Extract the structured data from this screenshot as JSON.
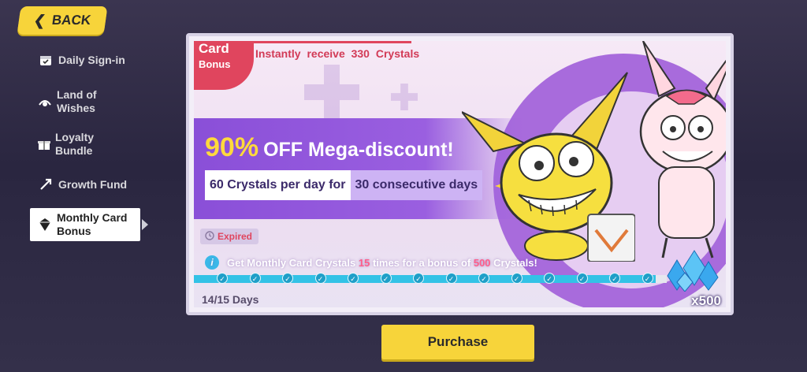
{
  "back": {
    "label": "BACK"
  },
  "sidebar": {
    "items": [
      {
        "label": "Daily Sign-in",
        "icon": "calendar-icon"
      },
      {
        "label": "Land of Wishes",
        "icon": "wish-icon"
      },
      {
        "label": "Loyalty Bundle",
        "icon": "gift-box-icon"
      },
      {
        "label": "Growth Fund",
        "icon": "growth-icon"
      },
      {
        "label": "Monthly Card Bonus",
        "icon": "crystal-icon",
        "active": true
      }
    ]
  },
  "card": {
    "badge_line1": "Card",
    "badge_line2": "Bonus",
    "instant_text": "Instantly receive 330 Crystals",
    "headline_pct": "90%",
    "headline_rest": "OFF Mega-discount!",
    "perday_a": "60 Crystals per day for",
    "perday_b": "30 consecutive days",
    "status": "Expired",
    "info_prefix": "Get Monthly Card Crystals",
    "info_times": "15",
    "info_mid": "times for a bonus of",
    "info_bonus": "500",
    "info_suffix": "Crystals!",
    "progress_days": "14/15 Days",
    "progress_done": 14,
    "progress_total": 15,
    "reward_count": "x500"
  },
  "purchase": {
    "label": "Purchase"
  },
  "colors": {
    "accent_yellow": "#f7d43a",
    "badge_red": "#e0455e",
    "band_purple": "#8a4fd8",
    "progress_cyan": "#33c2e6"
  }
}
